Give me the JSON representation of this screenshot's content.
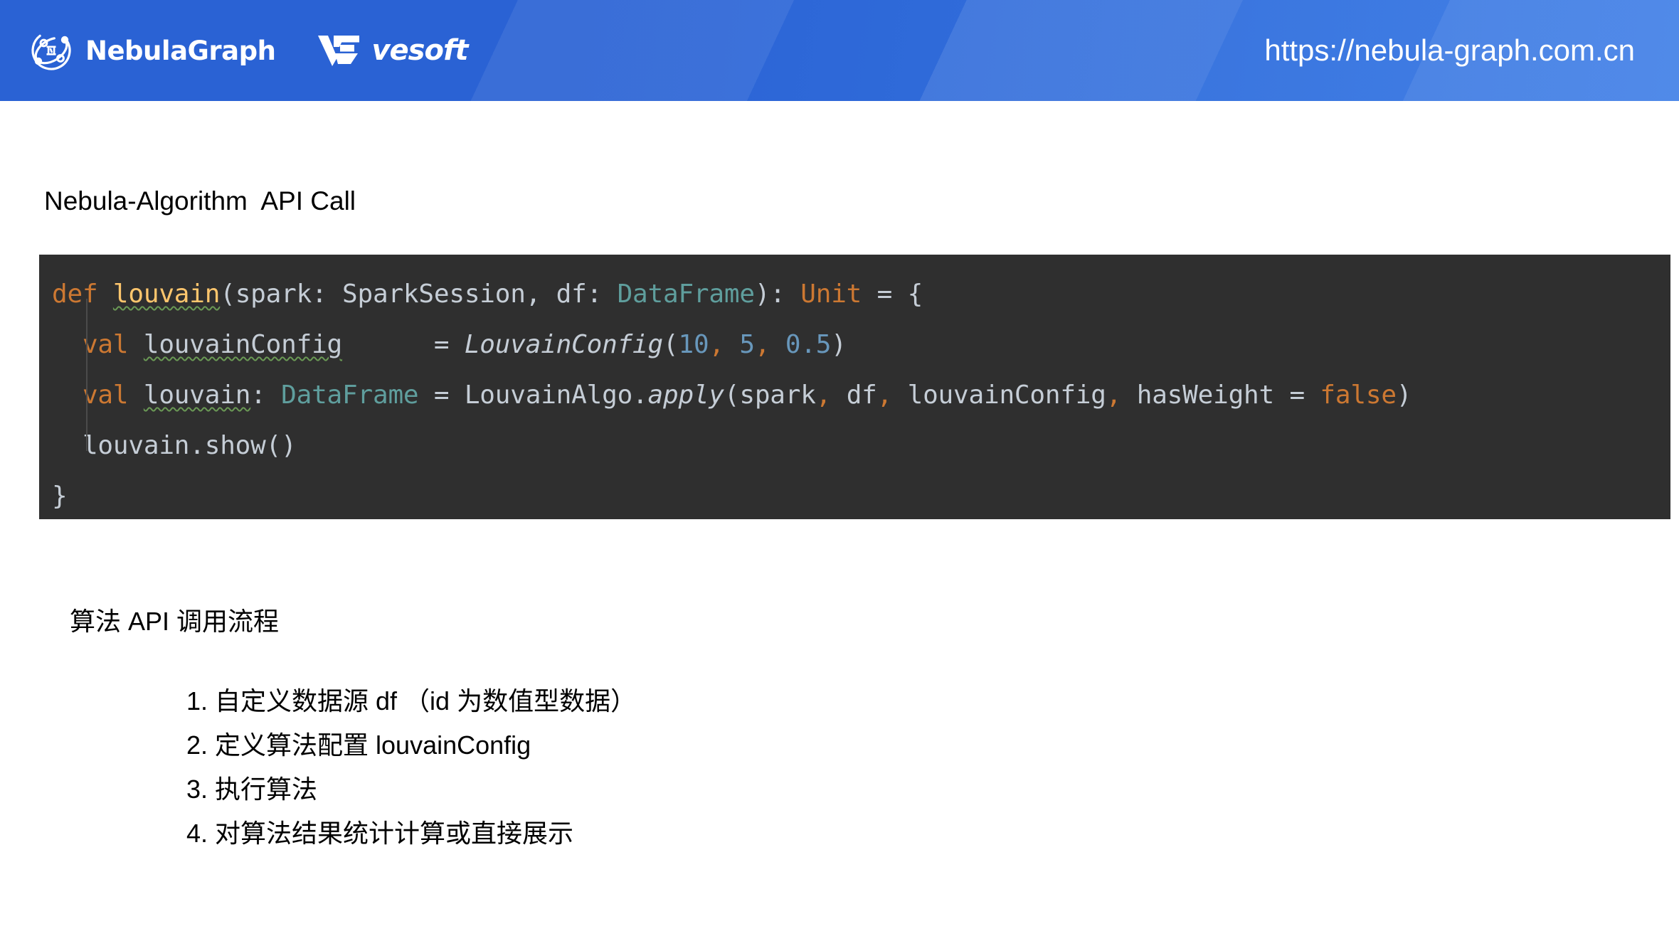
{
  "banner": {
    "brand_name": "NebulaGraph",
    "partner_name": "vesoft",
    "url": "https://nebula-graph.com.cn",
    "colors": {
      "gradient_start": "#2a62d4",
      "gradient_end": "#3b7ce6",
      "text": "#ffffff"
    }
  },
  "slide": {
    "title": "Nebula-Algorithm  API Call"
  },
  "code": {
    "background": "#2f2f2f",
    "default_text_color": "#c5cdd6",
    "language": "scala",
    "plain_text": "def louvain(spark: SparkSession, df: DataFrame): Unit = {\n  val louvainConfig      = LouvainConfig(10, 5, 0.5)\n  val louvain: DataFrame = LouvainAlgo.apply(spark, df, louvainConfig, hasWeight = false)\n  louvain.show()\n}",
    "lines": [
      {
        "n": 1,
        "tokens": [
          {
            "t": "def",
            "k": "kw"
          },
          {
            "t": " ",
            "k": "plain"
          },
          {
            "t": "louvain",
            "k": "fn",
            "squiggle": true
          },
          {
            "t": "(spark: SparkSession, df: ",
            "k": "plain"
          },
          {
            "t": "DataFrame",
            "k": "type"
          },
          {
            "t": "): ",
            "k": "plain"
          },
          {
            "t": "Unit",
            "k": "kw"
          },
          {
            "t": " = {",
            "k": "plain"
          }
        ]
      },
      {
        "n": 2,
        "tokens": [
          {
            "t": "  ",
            "k": "plain"
          },
          {
            "t": "val",
            "k": "kw"
          },
          {
            "t": " ",
            "k": "plain"
          },
          {
            "t": "louvainConfig",
            "k": "plain",
            "squiggle": true
          },
          {
            "t": "      = ",
            "k": "plain"
          },
          {
            "t": "LouvainConfig",
            "k": "ital"
          },
          {
            "t": "(",
            "k": "plain"
          },
          {
            "t": "10",
            "k": "num"
          },
          {
            "t": ",",
            "k": "punct"
          },
          {
            "t": " ",
            "k": "plain"
          },
          {
            "t": "5",
            "k": "num"
          },
          {
            "t": ",",
            "k": "punct"
          },
          {
            "t": " ",
            "k": "plain"
          },
          {
            "t": "0.5",
            "k": "num"
          },
          {
            "t": ")",
            "k": "plain"
          }
        ]
      },
      {
        "n": 3,
        "tokens": [
          {
            "t": "  ",
            "k": "plain"
          },
          {
            "t": "val",
            "k": "kw"
          },
          {
            "t": " ",
            "k": "plain"
          },
          {
            "t": "louvain",
            "k": "plain",
            "squiggle": true
          },
          {
            "t": ": ",
            "k": "plain"
          },
          {
            "t": "DataFrame",
            "k": "type"
          },
          {
            "t": " = LouvainAlgo.",
            "k": "plain"
          },
          {
            "t": "apply",
            "k": "ital"
          },
          {
            "t": "(spark",
            "k": "plain"
          },
          {
            "t": ",",
            "k": "punct"
          },
          {
            "t": " df",
            "k": "plain"
          },
          {
            "t": ",",
            "k": "punct"
          },
          {
            "t": " louvainConfig",
            "k": "plain"
          },
          {
            "t": ",",
            "k": "punct"
          },
          {
            "t": " hasWeight = ",
            "k": "plain"
          },
          {
            "t": "false",
            "k": "kw"
          },
          {
            "t": ")",
            "k": "plain"
          }
        ]
      },
      {
        "n": 4,
        "tokens": [
          {
            "t": "  louvain.show()",
            "k": "plain"
          }
        ]
      },
      {
        "n": 5,
        "tokens": [
          {
            "t": "}",
            "k": "plain"
          }
        ]
      }
    ]
  },
  "flow": {
    "heading": "算法 API 调用流程",
    "items": [
      "1. 自定义数据源 df （id 为数值型数据）",
      "2. 定义算法配置 louvainConfig",
      "3. 执行算法",
      "4. 对算法结果统计计算或直接展示"
    ]
  }
}
